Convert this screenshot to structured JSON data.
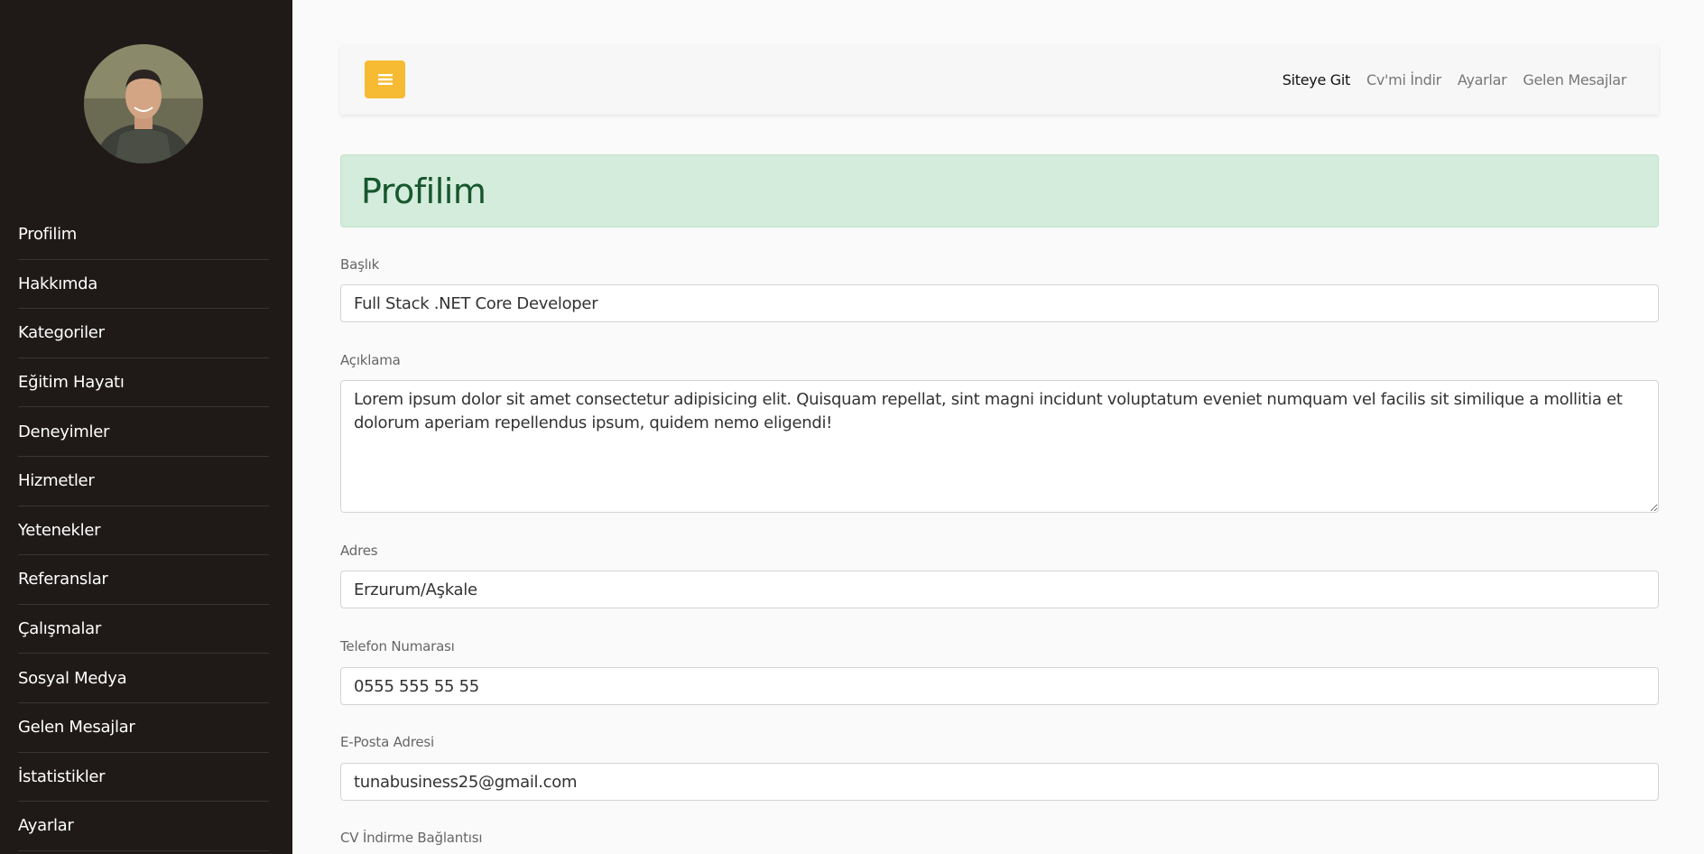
{
  "sidebar": {
    "avatar_alt": "profile-photo",
    "items": [
      {
        "label": "Profilim"
      },
      {
        "label": "Hakkımda"
      },
      {
        "label": "Kategoriler"
      },
      {
        "label": "Eğitim Hayatı"
      },
      {
        "label": "Deneyimler"
      },
      {
        "label": "Hizmetler"
      },
      {
        "label": "Yetenekler"
      },
      {
        "label": "Referanslar"
      },
      {
        "label": "Çalışmalar"
      },
      {
        "label": "Sosyal Medya"
      },
      {
        "label": "Gelen Mesajlar"
      },
      {
        "label": "İstatistikler"
      },
      {
        "label": "Ayarlar"
      }
    ]
  },
  "topbar": {
    "menu_icon": "hamburger-icon",
    "links": [
      {
        "label": "Siteye Git"
      },
      {
        "label": "Cv'mi İndir"
      },
      {
        "label": "Ayarlar"
      },
      {
        "label": "Gelen Mesajlar"
      }
    ]
  },
  "page": {
    "title": "Profilim"
  },
  "form": {
    "baslik": {
      "label": "Başlık",
      "value": "Full Stack .NET Core Developer"
    },
    "aciklama": {
      "label": "Açıklama",
      "value": "Lorem ipsum dolor sit amet consectetur adipisicing elit. Quisquam repellat, sint magni incidunt voluptatum eveniet numquam vel facilis sit similique a mollitia et dolorum aperiam repellendus ipsum, quidem nemo eligendi!"
    },
    "adres": {
      "label": "Adres",
      "value": "Erzurum/Aşkale"
    },
    "telefon": {
      "label": "Telefon Numarası",
      "value": "0555 555 55 55"
    },
    "eposta": {
      "label": "E-Posta Adresi",
      "value": "tunabusiness25@gmail.com"
    },
    "cv": {
      "label": "CV İndirme Bağlantısı"
    }
  },
  "colors": {
    "sidebar_bg": "#1f1a18",
    "accent": "#f6bb33",
    "alert_bg": "#d4ecdb",
    "alert_text": "#17562d"
  }
}
